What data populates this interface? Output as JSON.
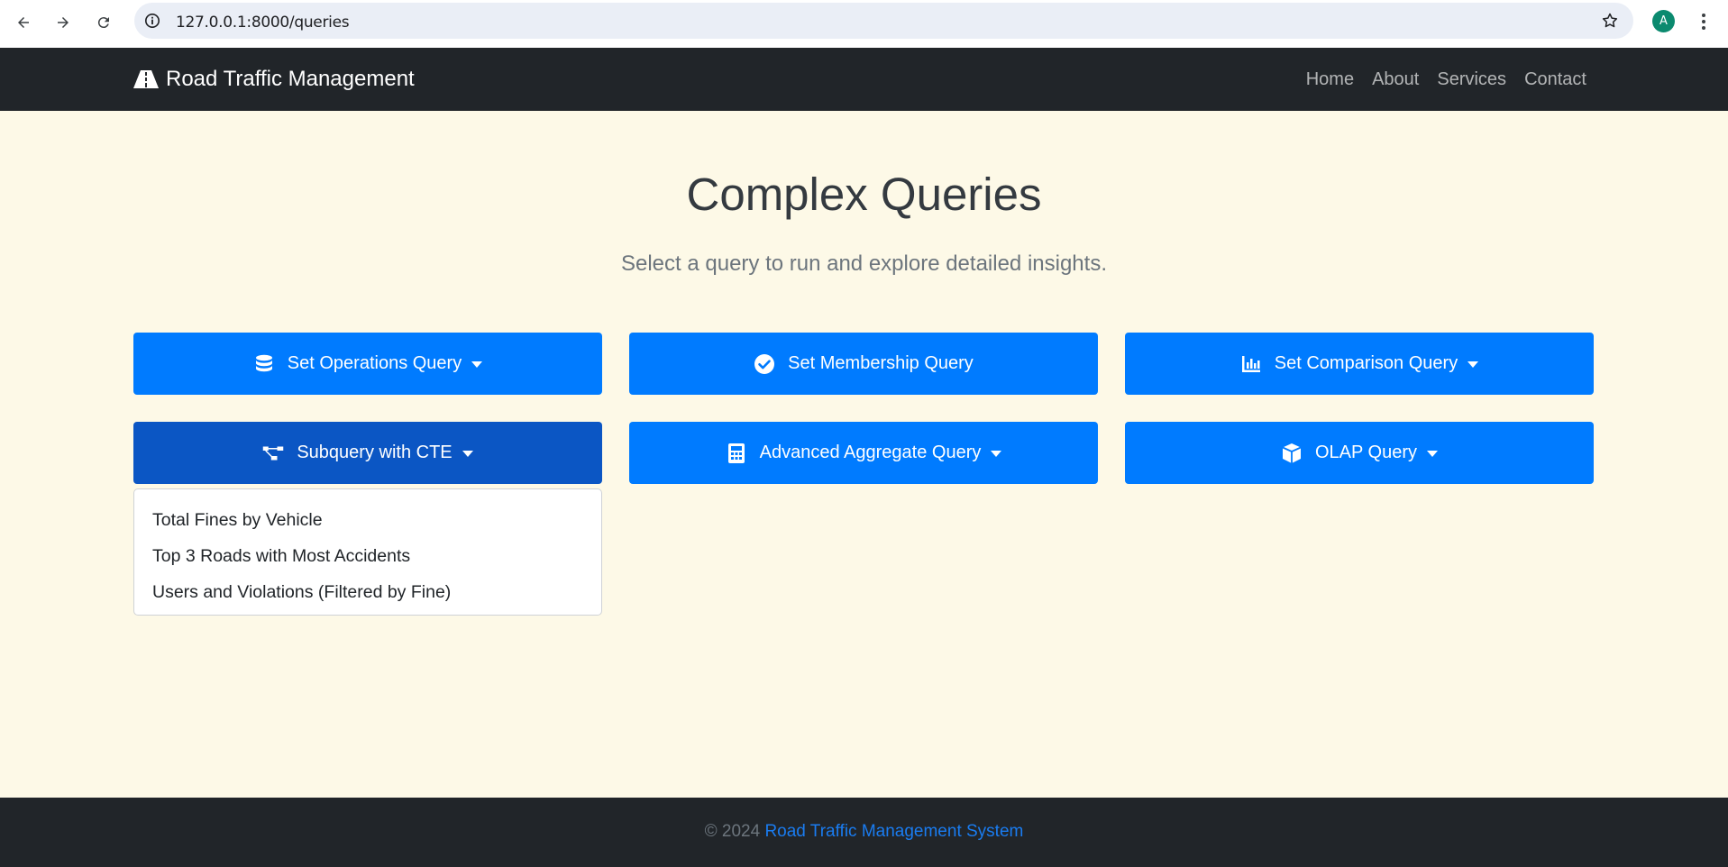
{
  "browser": {
    "url": "127.0.0.1:8000/queries",
    "avatar_letter": "A"
  },
  "navbar": {
    "brand": "Road Traffic Management",
    "links": [
      "Home",
      "About",
      "Services",
      "Contact"
    ]
  },
  "main": {
    "title": "Complex Queries",
    "subtitle": "Select a query to run and explore detailed insights.",
    "buttons": [
      {
        "label": "Set Operations Query",
        "icon": "database-icon",
        "dropdown": true
      },
      {
        "label": "Set Membership Query",
        "icon": "check-circle-icon",
        "dropdown": false
      },
      {
        "label": "Set Comparison Query",
        "icon": "bar-chart-icon",
        "dropdown": true
      },
      {
        "label": "Subquery with CTE",
        "icon": "project-diagram-icon",
        "dropdown": true,
        "active": true
      },
      {
        "label": "Advanced Aggregate Query",
        "icon": "calculator-icon",
        "dropdown": true
      },
      {
        "label": "OLAP Query",
        "icon": "cube-icon",
        "dropdown": true
      }
    ],
    "open_dropdown_items": [
      "Total Fines by Vehicle",
      "Top 3 Roads with Most Accidents",
      "Users and Violations (Filtered by Fine)"
    ]
  },
  "footer": {
    "copyright": "© 2024",
    "link": "Road Traffic Management System"
  },
  "colors": {
    "primary": "#007bff",
    "primary_active": "#0b56c4",
    "dark": "#212529",
    "page_bg": "#fdf9e7"
  }
}
